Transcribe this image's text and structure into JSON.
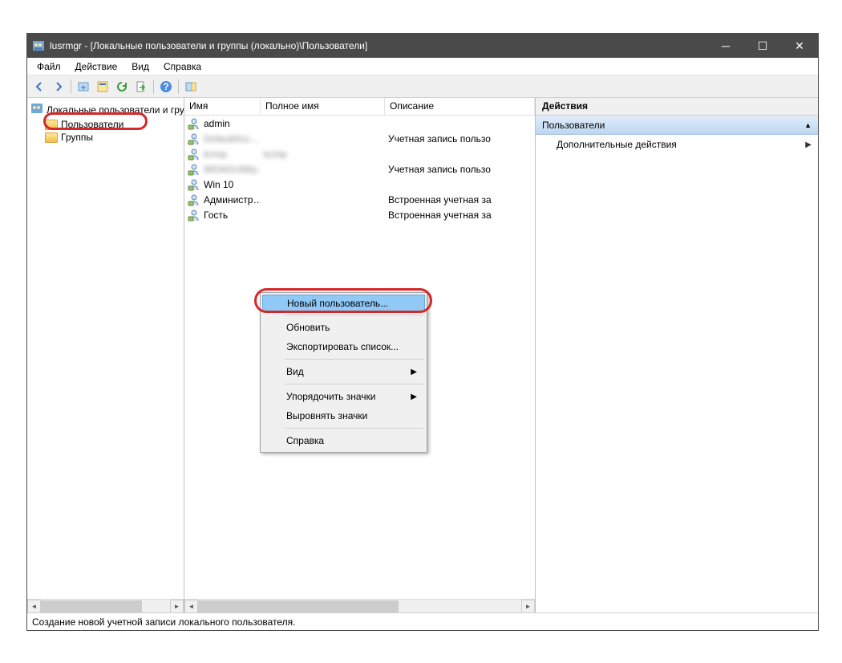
{
  "titlebar": {
    "title": "lusrmgr - [Локальные пользователи и группы (локально)\\Пользователи]"
  },
  "menu": {
    "file": "Файл",
    "action": "Действие",
    "view": "Вид",
    "help": "Справка"
  },
  "tree": {
    "root": "Локальные пользователи и группы",
    "users": "Пользователи",
    "groups": "Группы"
  },
  "columns": {
    "name": "Имя",
    "fullname": "Полное имя",
    "description": "Описание"
  },
  "users_list": [
    {
      "name": "admin",
      "fullname": "",
      "desc": ""
    },
    {
      "name": "DefaultAcc…",
      "fullname": "",
      "desc": "Учетная запись пользо",
      "blur_name": true
    },
    {
      "name": "kcmp",
      "fullname": "kcmp",
      "desc": "",
      "blur_name": true,
      "blur_full": true
    },
    {
      "name": "WDAGUtility…",
      "fullname": "",
      "desc": "Учетная запись пользо",
      "blur_name": true
    },
    {
      "name": "Win 10",
      "fullname": "",
      "desc": ""
    },
    {
      "name": "Администр…",
      "fullname": "",
      "desc": "Встроенная учетная за"
    },
    {
      "name": "Гость",
      "fullname": "",
      "desc": "Встроенная учетная за"
    }
  ],
  "context_menu": {
    "new_user": "Новый пользователь...",
    "refresh": "Обновить",
    "export": "Экспортировать список...",
    "view": "Вид",
    "arrange": "Упорядочить значки",
    "align": "Выровнять значки",
    "help": "Справка"
  },
  "actions_pane": {
    "header": "Действия",
    "section": "Пользователи",
    "item": "Дополнительные действия"
  },
  "statusbar": "Создание новой учетной записи локального пользователя."
}
